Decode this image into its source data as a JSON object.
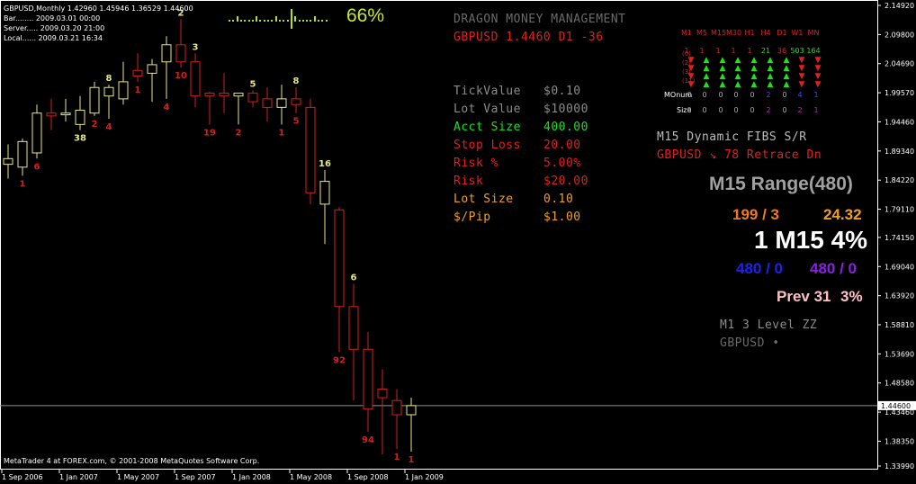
{
  "chart_header": {
    "symbol_line": "GBPUSD,Monthly  1.42960 1.45946 1.36529 1.44600",
    "bar_line": "Bar........ 2009.03.01 00:00",
    "server_line": "Server..... 2009.03.20 21:00",
    "local_line": "Local...... 2009.03.21 16:34"
  },
  "progress": {
    "value_label": "66%",
    "fraction": 0.66
  },
  "money_mgmt": {
    "title": "DRAGON MONEY MANAGEMENT",
    "pair_line": "GBPUSD 1.4460 D1 -36",
    "rows": [
      {
        "label": "TickValue",
        "value": "$0.10",
        "color": "#8c8c8c"
      },
      {
        "label": "Lot Value",
        "value": "$10000",
        "color": "#8c8c8c"
      },
      {
        "label": "Acct Size",
        "value": "400.00",
        "color": "#22dd22"
      },
      {
        "label": "Stop Loss",
        "value": "20.00",
        "color": "#e02020"
      },
      {
        "label": "Risk %",
        "value": "5.00%",
        "color": "#e02020"
      },
      {
        "label": "Risk",
        "value": "$20.00",
        "color": "#e02020"
      },
      {
        "label": "Lot Size",
        "value": "0.10",
        "color": "#f0a020"
      },
      {
        "label": "$/Pip",
        "value": "$1.00",
        "color": "#f0a020"
      }
    ]
  },
  "mtf": {
    "timeframes": [
      "M1",
      "M5",
      "M15",
      "M30",
      "H1",
      "H4",
      "D1",
      "W1",
      "MN"
    ],
    "row_labels": [
      "(0)",
      "(2)",
      "(3)",
      "(11)"
    ],
    "counts": [
      {
        "v": "1",
        "c": "#e02020"
      },
      {
        "v": "1",
        "c": "#e02020"
      },
      {
        "v": "1",
        "c": "#e02020"
      },
      {
        "v": "1",
        "c": "#e02020"
      },
      {
        "v": "1",
        "c": "#e02020"
      },
      {
        "v": "21",
        "c": "#22dd22"
      },
      {
        "v": "36",
        "c": "#e02020"
      },
      {
        "v": "503",
        "c": "#22dd22"
      },
      {
        "v": "164",
        "c": "#22dd22"
      }
    ],
    "arrows": [
      [
        "down",
        "up",
        "up",
        "up",
        "up",
        "up",
        "up",
        "down",
        "down"
      ],
      [
        "down",
        "up",
        "up",
        "up",
        "up",
        "up",
        "up",
        "down",
        "down"
      ],
      [
        "down",
        "up",
        "up",
        "up",
        "up",
        "up",
        "up",
        "down",
        "down"
      ],
      [
        "down",
        "up",
        "up",
        "up",
        "up",
        "up",
        "up",
        "down",
        "down"
      ]
    ],
    "monum_label": "MOnum",
    "monum": [
      {
        "v": "0",
        "c": "#aaaaaa"
      },
      {
        "v": "0",
        "c": "#aaaaaa"
      },
      {
        "v": "0",
        "c": "#aaaaaa"
      },
      {
        "v": "0",
        "c": "#aaaaaa"
      },
      {
        "v": "0",
        "c": "#aaaaaa"
      },
      {
        "v": "2",
        "c": "#3050ff"
      },
      {
        "v": "0",
        "c": "#aaaaaa"
      },
      {
        "v": "4",
        "c": "#3050ff"
      },
      {
        "v": "1",
        "c": "#3050ff"
      }
    ],
    "size_label": "Size",
    "size": [
      {
        "v": "0",
        "c": "#aaaaaa"
      },
      {
        "v": "0",
        "c": "#aaaaaa"
      },
      {
        "v": "0",
        "c": "#aaaaaa"
      },
      {
        "v": "0",
        "c": "#aaaaaa"
      },
      {
        "v": "0",
        "c": "#aaaaaa"
      },
      {
        "v": "2",
        "c": "#c020c0"
      },
      {
        "v": "0",
        "c": "#aaaaaa"
      },
      {
        "v": "2",
        "c": "#c020c0"
      },
      {
        "v": "1",
        "c": "#c020c0"
      }
    ],
    "colors": {
      "up": "#22dd22",
      "down": "#e02020"
    }
  },
  "fibs": {
    "title": "M15 Dynamic FIBS S/R",
    "line": "GBPUSD ↘ 78 Retrace Dn"
  },
  "range": {
    "title": "M15 Range(480)",
    "left_val": "199 / 3",
    "right_val": "24.32",
    "main": "1 M15 4%",
    "blue_val": "480 / 0",
    "purple_val": "480 / 0",
    "prev_label": "Prev 31",
    "prev_pct": "3%"
  },
  "zz": {
    "title": "M1 3 Level ZZ",
    "line": "GBPUSD •"
  },
  "price_axis": {
    "ticks": [
      "2.14920",
      "2.09800",
      "2.04690",
      "1.99570",
      "1.94460",
      "1.89340",
      "1.84220",
      "1.79110",
      "1.74150",
      "1.69040",
      "1.63920",
      "1.58810",
      "1.53690",
      "1.48580",
      "1.43460",
      "1.38350",
      "1.33990"
    ],
    "current": "1.44600"
  },
  "time_axis": {
    "labels": [
      "1 Sep 2006",
      "1 Jan 2007",
      "1 May 2007",
      "1 Sep 2007",
      "1 Jan 2008",
      "1 May 2008",
      "1 Sep 2008",
      "1 Jan 2009"
    ]
  },
  "copyright": "MetaTrader 4 at FOREX.com, © 2001-2008 MetaQuotes Software Corp.",
  "chart_data": {
    "type": "candlestick",
    "colors": {
      "bull": "#e6e68a",
      "bear": "#d02020"
    },
    "candles": [
      {
        "o": 1.87,
        "h": 1.905,
        "l": 1.845,
        "c": 1.88
      },
      {
        "o": 1.865,
        "h": 1.915,
        "l": 1.85,
        "c": 1.91
      },
      {
        "o": 1.89,
        "h": 1.975,
        "l": 1.88,
        "c": 1.96
      },
      {
        "o": 1.96,
        "h": 1.985,
        "l": 1.93,
        "c": 1.955
      },
      {
        "o": 1.957,
        "h": 1.985,
        "l": 1.945,
        "c": 1.96
      },
      {
        "o": 1.94,
        "h": 1.99,
        "l": 1.93,
        "c": 1.965
      },
      {
        "o": 1.96,
        "h": 2.015,
        "l": 1.955,
        "c": 2.005
      },
      {
        "o": 1.99,
        "h": 2.01,
        "l": 1.95,
        "c": 2.005
      },
      {
        "o": 1.985,
        "h": 2.05,
        "l": 1.975,
        "c": 2.015
      },
      {
        "o": 2.035,
        "h": 2.065,
        "l": 2.015,
        "c": 2.025
      },
      {
        "o": 2.03,
        "h": 2.055,
        "l": 1.98,
        "c": 2.045
      },
      {
        "o": 2.05,
        "h": 2.095,
        "l": 1.985,
        "c": 2.08
      },
      {
        "o": 2.08,
        "h": 2.125,
        "l": 2.04,
        "c": 2.05
      },
      {
        "o": 2.05,
        "h": 2.065,
        "l": 1.97,
        "c": 1.99
      },
      {
        "o": 1.995,
        "h": 1.998,
        "l": 1.94,
        "c": 1.99
      },
      {
        "o": 1.995,
        "h": 2.03,
        "l": 1.96,
        "c": 1.99
      },
      {
        "o": 1.99,
        "h": 1.992,
        "l": 1.94,
        "c": 1.995
      },
      {
        "o": 1.995,
        "h": 2.0,
        "l": 1.97,
        "c": 1.98
      },
      {
        "o": 1.985,
        "h": 2.005,
        "l": 1.945,
        "c": 1.97
      },
      {
        "o": 1.97,
        "h": 2.01,
        "l": 1.94,
        "c": 1.985
      },
      {
        "o": 1.985,
        "h": 2.005,
        "l": 1.96,
        "c": 1.975
      },
      {
        "o": 1.97,
        "h": 1.985,
        "l": 1.8,
        "c": 1.82
      },
      {
        "o": 1.8,
        "h": 1.86,
        "l": 1.73,
        "c": 1.84
      },
      {
        "o": 1.79,
        "h": 1.795,
        "l": 1.54,
        "c": 1.62
      },
      {
        "o": 1.62,
        "h": 1.66,
        "l": 1.455,
        "c": 1.545
      },
      {
        "o": 1.545,
        "h": 1.575,
        "l": 1.4,
        "c": 1.44
      },
      {
        "o": 1.475,
        "h": 1.51,
        "l": 1.36,
        "c": 1.46
      },
      {
        "o": 1.455,
        "h": 1.475,
        "l": 1.37,
        "c": 1.43
      },
      {
        "o": 1.43,
        "h": 1.46,
        "l": 1.365,
        "c": 1.446
      }
    ],
    "labels": [
      {
        "i": 1,
        "text": "1",
        "pos": "below",
        "color": "#d02020"
      },
      {
        "i": 2,
        "text": "6",
        "pos": "below",
        "color": "#d02020"
      },
      {
        "i": 5,
        "text": "38",
        "pos": "below",
        "color": "#e6e68a"
      },
      {
        "i": 6,
        "text": "2",
        "pos": "below",
        "color": "#d02020"
      },
      {
        "i": 7,
        "text": "8",
        "pos": "above",
        "color": "#e6e68a"
      },
      {
        "i": 7,
        "text": "4",
        "pos": "below",
        "color": "#d02020"
      },
      {
        "i": 9,
        "text": "1",
        "pos": "below",
        "color": "#d02020"
      },
      {
        "i": 11,
        "text": "4",
        "pos": "below",
        "color": "#d02020"
      },
      {
        "i": 12,
        "text": "2",
        "pos": "above",
        "color": "#e6e68a"
      },
      {
        "i": 12,
        "text": "10",
        "pos": "below",
        "color": "#d02020"
      },
      {
        "i": 13,
        "text": "3",
        "pos": "above",
        "color": "#e6e68a"
      },
      {
        "i": 14,
        "text": "19",
        "pos": "below",
        "color": "#d02020"
      },
      {
        "i": 16,
        "text": "2",
        "pos": "below",
        "color": "#d02020"
      },
      {
        "i": 17,
        "text": "5",
        "pos": "above",
        "color": "#e6e68a"
      },
      {
        "i": 19,
        "text": "1",
        "pos": "below",
        "color": "#d02020"
      },
      {
        "i": 20,
        "text": "8",
        "pos": "above",
        "color": "#e6e68a"
      },
      {
        "i": 20,
        "text": "5",
        "pos": "below",
        "color": "#d02020"
      },
      {
        "i": 22,
        "text": "16",
        "pos": "above",
        "color": "#e6e68a"
      },
      {
        "i": 23,
        "text": "92",
        "pos": "below",
        "color": "#d02020"
      },
      {
        "i": 24,
        "text": "6",
        "pos": "above",
        "color": "#e6e68a"
      },
      {
        "i": 25,
        "text": "94",
        "pos": "below",
        "color": "#d02020"
      },
      {
        "i": 27,
        "text": "1",
        "pos": "below",
        "color": "#d02020"
      },
      {
        "i": 28,
        "text": "1",
        "pos": "below",
        "color": "#d02020"
      }
    ]
  }
}
